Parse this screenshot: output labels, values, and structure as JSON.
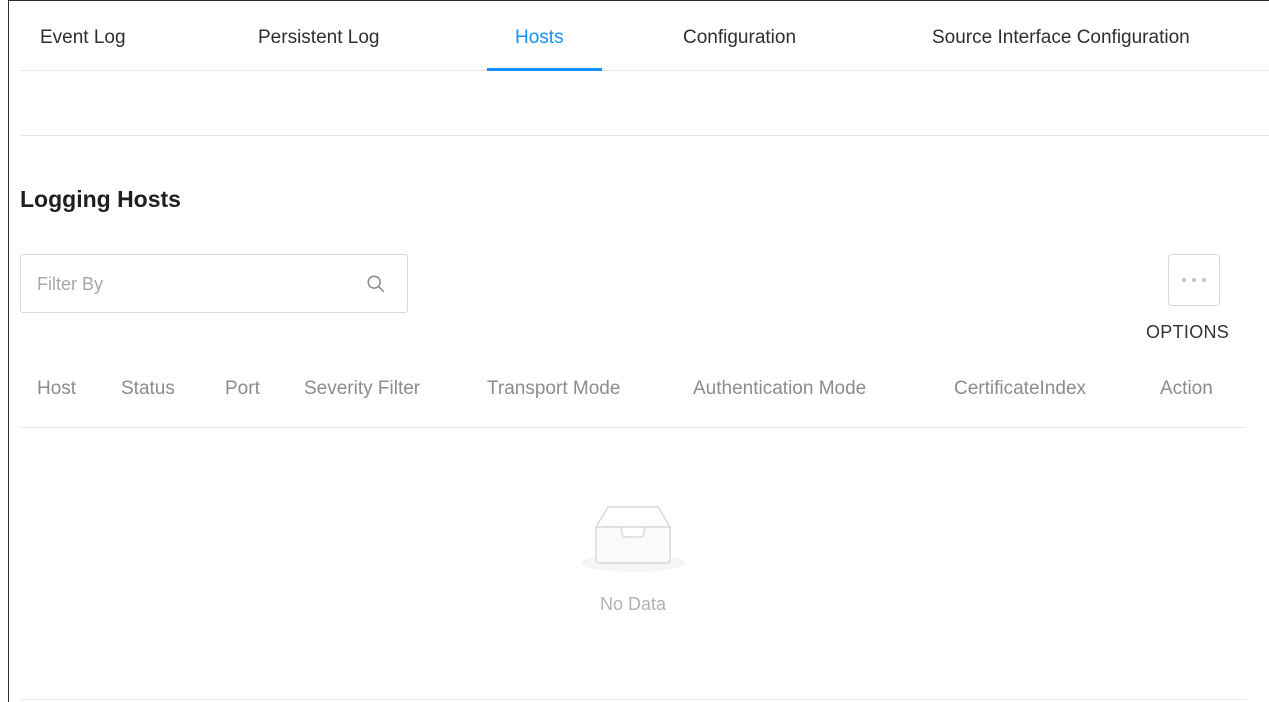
{
  "tabs": [
    {
      "label": "Event Log",
      "active": false
    },
    {
      "label": "Persistent Log",
      "active": false
    },
    {
      "label": "Hosts",
      "active": true
    },
    {
      "label": "Configuration",
      "active": false
    },
    {
      "label": "Source Interface Configuration",
      "active": false
    }
  ],
  "section_title": "Logging Hosts",
  "filter": {
    "placeholder": "Filter By",
    "value": "",
    "icon": "search-icon"
  },
  "options": {
    "label": "OPTIONS",
    "icon": "ellipsis-icon"
  },
  "table": {
    "columns": [
      "Host",
      "Status",
      "Port",
      "Severity Filter",
      "Transport Mode",
      "Authentication Mode",
      "CertificateIndex",
      "Action"
    ],
    "rows": [],
    "empty_text": "No Data",
    "empty_icon": "empty-inbox-icon"
  },
  "colors": {
    "accent": "#1890ff",
    "border": "#d9d9d9",
    "muted": "#8c8c8c"
  }
}
